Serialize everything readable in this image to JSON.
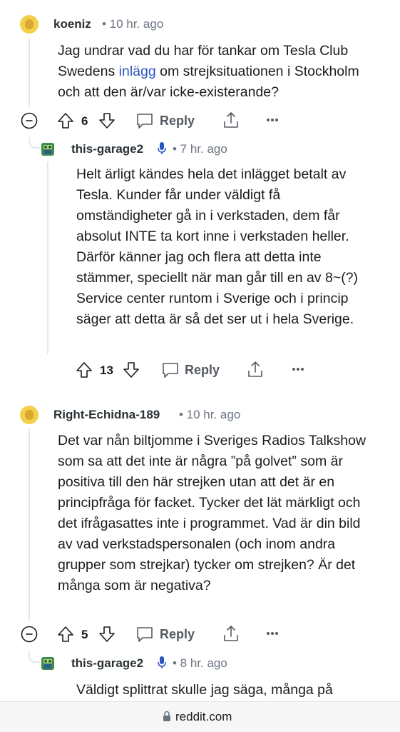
{
  "comments": [
    {
      "author": "koeniz",
      "meta": "• 10 hr. ago",
      "text_before_link": "Jag undrar vad du har för tankar om Tesla Club Swedens ",
      "link_text": "inlägg",
      "text_after_link": " om strejksituationen i Stockholm och att den är/var icke-existerande?",
      "votes": "6",
      "reply_label": "Reply",
      "reply": {
        "author": "this-garage2",
        "meta": "• 7 hr. ago",
        "text": "Helt ärligt kändes hela det inlägget betalt av Tesla. Kunder får under väldigt få omständigheter gå in i verkstaden, dem får absolut INTE ta kort inne i verkstaden heller. Därför känner jag och flera att detta inte stämmer, speciellt när man går till en av 8~(?) Service center runtom i Sverige och i princip säger att detta är så det ser ut i hela Sverige.",
        "votes": "13",
        "reply_label": "Reply"
      }
    },
    {
      "author": "Right-Echidna-189",
      "meta": "• 10 hr. ago",
      "text": "Det var nån biltjomme i Sveriges Radios Talkshow som sa att det inte är några ”på golvet” som är positiva till den här strejken utan att det är en principfråga för facket. Tycker det lät märkligt och det ifrågasattes inte i programmet. Vad är din bild av vad verkstadspersonalen (och inom andra grupper som strejkar) tycker om strejken? Är det många som är negativa?",
      "votes": "5",
      "reply_label": "Reply",
      "reply": {
        "author": "this-garage2",
        "meta": "• 8 hr. ago",
        "text": "Väldigt splittrat skulle jag säga, många på"
      }
    }
  ],
  "footer": {
    "domain": "reddit.com"
  },
  "icons": {
    "collapse": "collapse-minus-icon",
    "upvote": "upvote-arrow-icon",
    "downvote": "downvote-arrow-icon",
    "reply": "chat-bubble-icon",
    "share": "share-icon",
    "more": "more-dots-icon",
    "mic": "microphone-icon",
    "lock": "lock-icon"
  },
  "colors": {
    "link": "#2b56c2",
    "mic": "#2b56c2",
    "avatar_yellow": "#f2d04b",
    "avatar_green": "#3f8a4a"
  }
}
